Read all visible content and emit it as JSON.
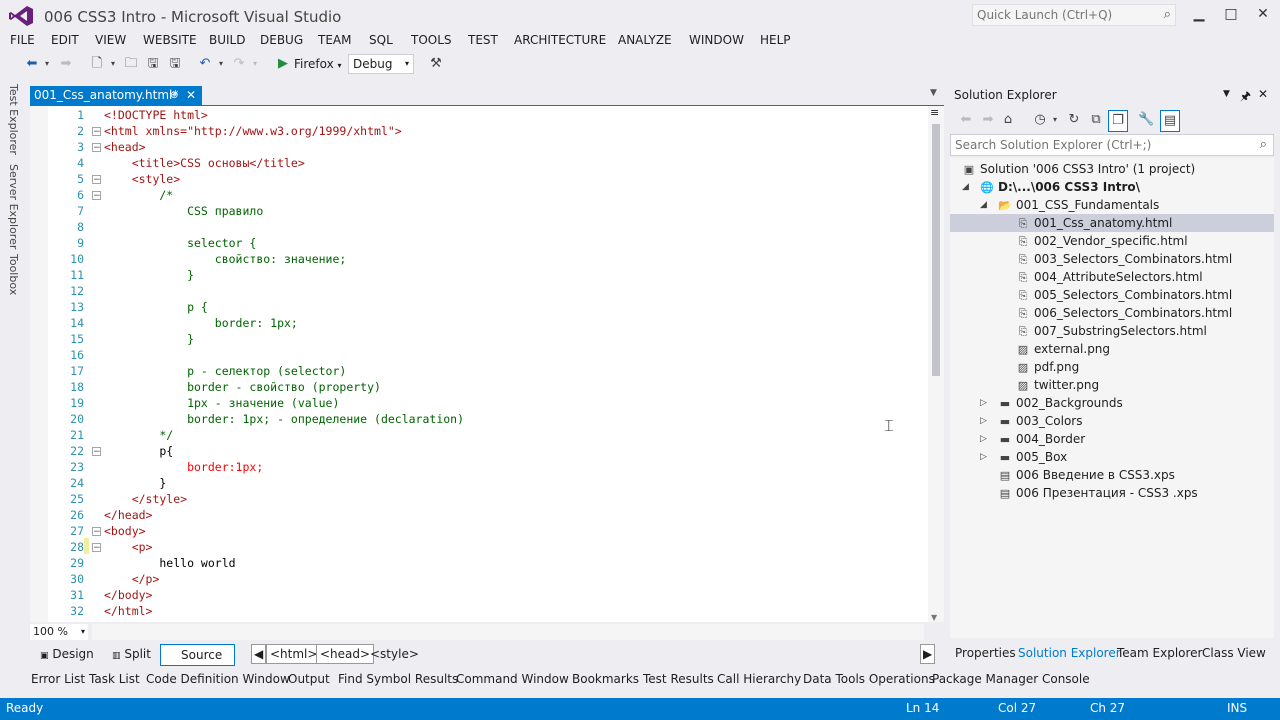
{
  "window": {
    "title": "006 CSS3 Intro - Microsoft Visual Studio",
    "quick_launch_placeholder": "Quick Launch (Ctrl+Q)",
    "minimize": "▁",
    "maximize": "□",
    "close": "✕"
  },
  "menu": [
    "FILE",
    "EDIT",
    "VIEW",
    "WEBSITE",
    "BUILD",
    "DEBUG",
    "TEAM",
    "SQL",
    "TOOLS",
    "TEST",
    "ARCHITECTURE",
    "ANALYZE",
    "WINDOW",
    "HELP"
  ],
  "toolbar": {
    "run_target": "Firefox",
    "configuration": "Debug"
  },
  "side_tabs": [
    "Test Explorer",
    "Server Explorer",
    "Toolbox"
  ],
  "editor": {
    "tab_label": "001_Css_anatomy.html*",
    "zoom": "100 %",
    "lines": [
      "<!DOCTYPE html>",
      "<html xmlns=\"http://www.w3.org/1999/xhtml\">",
      "<head>",
      "    <title>CSS основы</title>",
      "    <style>",
      "        /*",
      "            CSS правило",
      "",
      "            selector {",
      "                свойство: значение;",
      "            }",
      "",
      "            p {",
      "                border: 1px;",
      "            }",
      "",
      "            p - селектор (selector)",
      "            border - свойство (property)",
      "            1px - значение (value)",
      "            border: 1px; - определение (declaration)",
      "        */",
      "        p{",
      "            border:1px;",
      "        }",
      "    </style>",
      "</head>",
      "<body>",
      "    <p>",
      "        hello world",
      "    </p>",
      "</body>",
      "</html>"
    ]
  },
  "view_bar": {
    "design": "Design",
    "split": "Split",
    "source": "Source",
    "breadcrumbs": [
      "<html>",
      "<head>",
      "<style>"
    ]
  },
  "solution_explorer": {
    "title": "Solution Explorer",
    "search_placeholder": "Search Solution Explorer (Ctrl+;)",
    "solution": "Solution '006 CSS3 Intro' (1 project)",
    "project": "D:\\...\\006 CSS3 Intro\\",
    "folder1": "001_CSS_Fundamentals",
    "files": [
      "001_Css_anatomy.html",
      "002_Vendor_specific.html",
      "003_Selectors_Combinators.html",
      "004_AttributeSelectors.html",
      "005_Selectors_Combinators.html",
      "006_Selectors_Combinators.html",
      "007_SubstringSelectors.html",
      "external.png",
      "pdf.png",
      "twitter.png"
    ],
    "folders": [
      "002_Backgrounds",
      "003_Colors",
      "004_Border",
      "005_Box"
    ],
    "docs": [
      "006 Введение в CSS3.xps",
      "006 Презентация - CSS3 .xps"
    ],
    "bottom_tabs": [
      "Properties",
      "Solution Explorer",
      "Team Explorer",
      "Class View"
    ]
  },
  "tool_windows": [
    "Error List",
    "Task List",
    "Code Definition Window",
    "Output",
    "Find Symbol Results",
    "Command Window",
    "Bookmarks",
    "Test Results",
    "Call Hierarchy",
    "Data Tools Operations",
    "Package Manager Console"
  ],
  "status": {
    "state": "Ready",
    "line": "Ln 14",
    "col": "Col 27",
    "ch": "Ch 27",
    "mode": "INS"
  },
  "colors": {
    "accent": "#007ACC",
    "background": "#EEEEF2",
    "selection": "#CCCEDB"
  }
}
